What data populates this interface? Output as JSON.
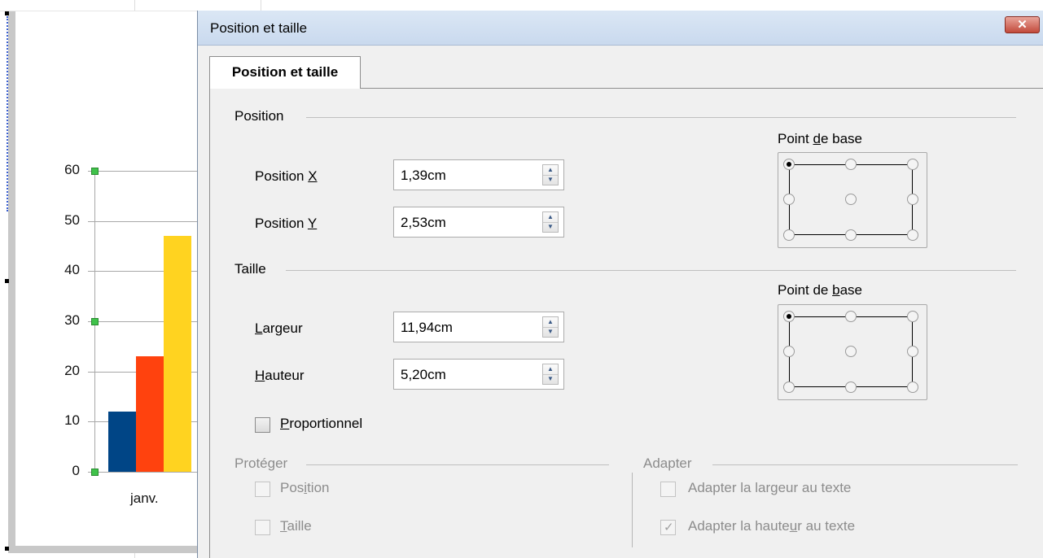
{
  "chart_data": {
    "type": "bar",
    "categories": [
      "janv."
    ],
    "series": [
      {
        "values": [
          12
        ]
      },
      {
        "values": [
          23
        ]
      },
      {
        "values": [
          47
        ]
      }
    ],
    "colors": [
      "#004586",
      "#ff420e",
      "#ffd320"
    ],
    "y_ticks": [
      "0",
      "10",
      "20",
      "30",
      "40",
      "50",
      "60"
    ],
    "ylim": [
      0,
      60
    ],
    "grid": true
  },
  "dialog": {
    "title": "Position et taille",
    "close_icon": "close-icon",
    "tab_label": "Position et taille",
    "position": {
      "section_title": "Position",
      "x_label_pre": "Position ",
      "x_label_key": "X",
      "x_value": "1,39cm",
      "y_label_pre": "Position ",
      "y_label_key": "Y",
      "y_value": "2,53cm",
      "base_label_pre": "Point ",
      "base_label_key": "d",
      "base_label_post": "e base"
    },
    "size": {
      "section_title": "Taille",
      "width_label_key": "L",
      "width_label_post": "argeur",
      "width_value": "11,94cm",
      "height_label_key": "H",
      "height_label_post": "auteur",
      "height_value": "5,20cm",
      "base_label_pre": "Point de ",
      "base_label_key": "b",
      "base_label_post": "ase",
      "proportional_key": "P",
      "proportional_post": "roportionnel"
    },
    "protect": {
      "section_title": "Protéger",
      "position_pre": "Pos",
      "position_key": "i",
      "position_post": "tion",
      "size_key": "T",
      "size_post": "aille"
    },
    "adapt": {
      "section_title": "Adapter",
      "width_pre": "Adapter la lar",
      "width_key": "g",
      "width_post": "eur au texte",
      "height_pre": "Adapter la haute",
      "height_key": "u",
      "height_post": "r au texte"
    }
  }
}
